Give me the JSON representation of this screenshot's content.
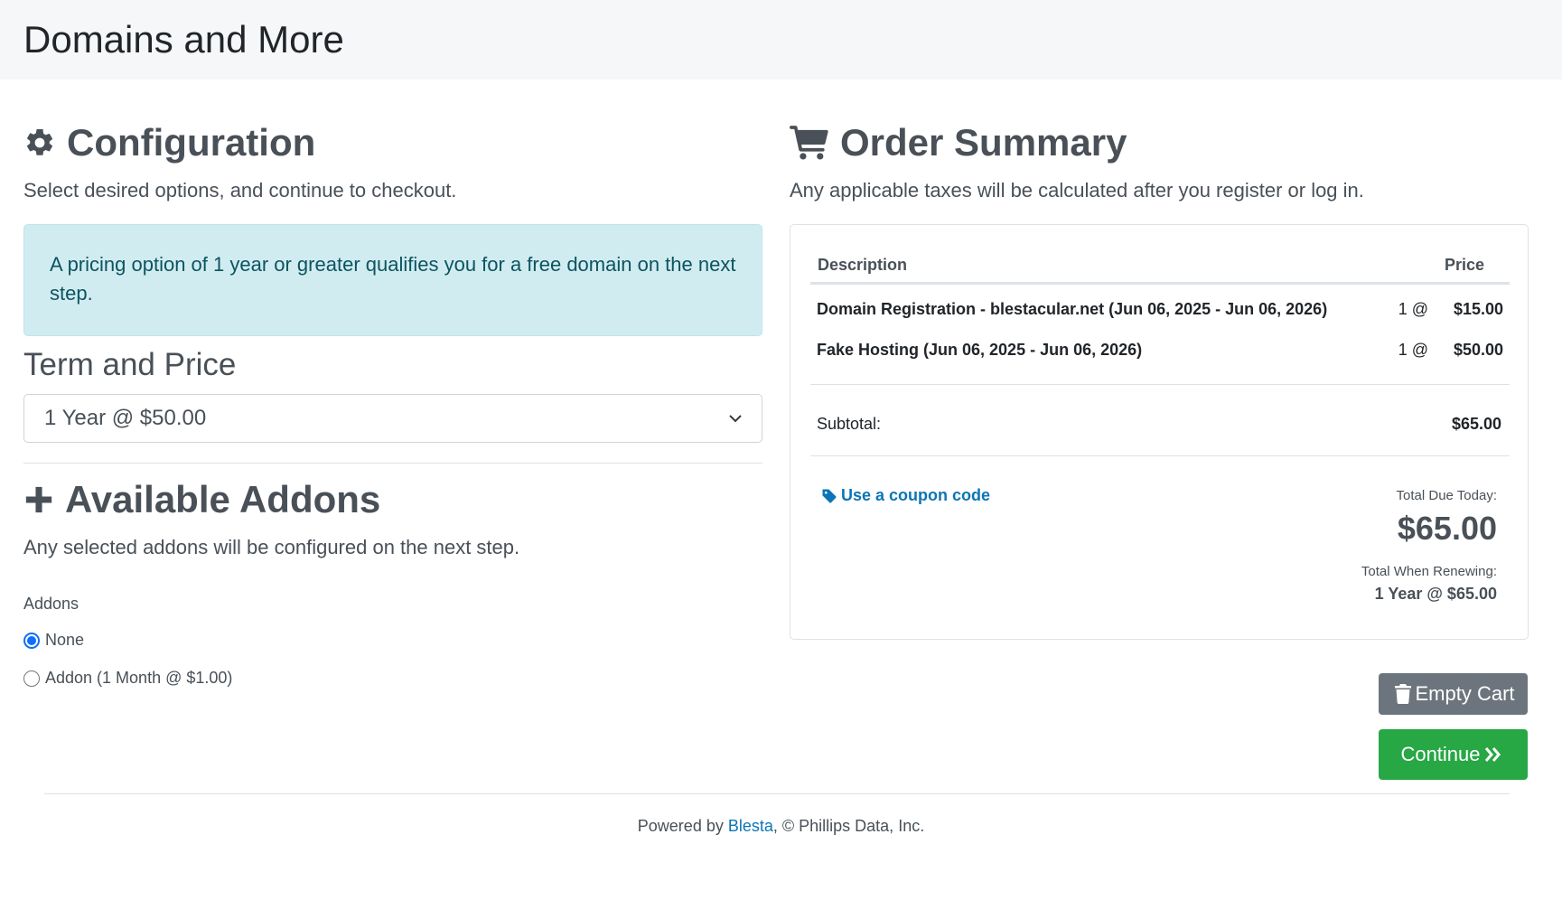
{
  "header": {
    "brand": "Domains and More"
  },
  "configuration": {
    "title": "Configuration",
    "subtitle": "Select desired options, and continue to checkout.",
    "alert": "A pricing option of 1 year or greater qualifies you for a free domain on the next step.",
    "term_label": "Term and Price",
    "term_selected": "1 Year @ $50.00"
  },
  "addons": {
    "title": "Available Addons",
    "subtitle": "Any selected addons will be configured on the next step.",
    "label": "Addons",
    "options": [
      {
        "label": "None",
        "checked": true
      },
      {
        "label": "Addon (1 Month @ $1.00)",
        "checked": false
      }
    ]
  },
  "summary": {
    "title": "Order Summary",
    "subtitle": "Any applicable taxes will be calculated after you register or log in.",
    "columns": {
      "description": "Description",
      "price": "Price"
    },
    "items": [
      {
        "description": "Domain Registration - blestacular.net (Jun 06, 2025 - Jun 06, 2026)",
        "qty": "1 @",
        "price": "$15.00"
      },
      {
        "description": "Fake Hosting (Jun 06, 2025 - Jun 06, 2026)",
        "qty": "1 @",
        "price": "$50.00"
      }
    ],
    "subtotal_label": "Subtotal:",
    "subtotal_value": "$65.00",
    "coupon_link": "Use a coupon code",
    "total_due_label": "Total Due Today:",
    "total_due_value": "$65.00",
    "renew_label": "Total When Renewing:",
    "renew_value": "1 Year @ $65.00"
  },
  "actions": {
    "empty_cart": "Empty Cart",
    "continue": "Continue"
  },
  "footer": {
    "prefix": "Powered by ",
    "link": "Blesta",
    "suffix": ", © Phillips Data, Inc."
  },
  "colors": {
    "alert_bg": "#d1ecf1",
    "link": "#0c75b5",
    "continue_btn": "#28a745",
    "empty_btn": "#6c757d"
  }
}
